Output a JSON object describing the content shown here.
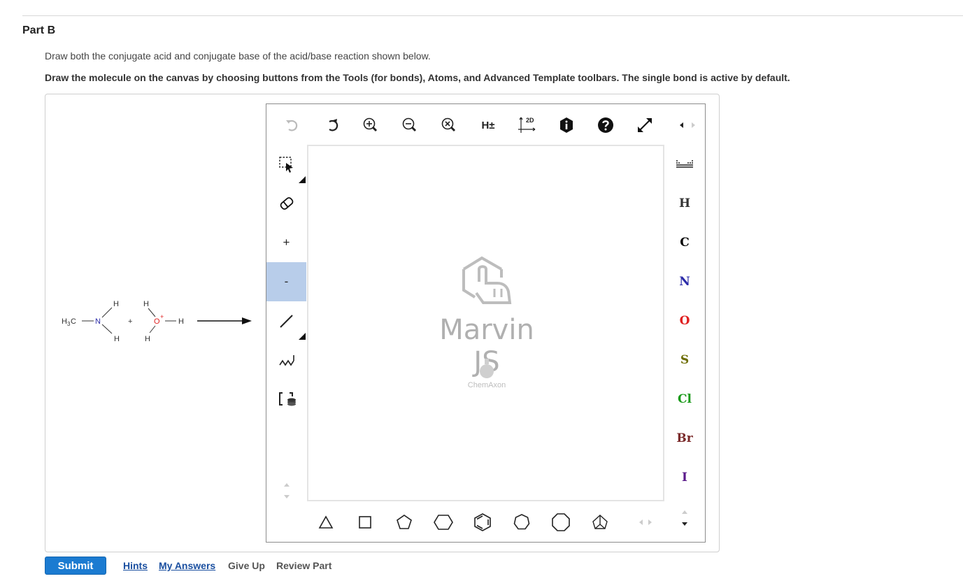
{
  "part": {
    "title": "Part B"
  },
  "instructions": {
    "line1": "Draw both the conjugate acid and conjugate base of the acid/base reaction shown below.",
    "line2": "Draw the molecule on the canvas by choosing buttons from the Tools (for bonds), Atoms, and Advanced Template toolbars. The single bond is active by default."
  },
  "reaction": {
    "methyl": "H",
    "methyl_sub": "3",
    "methyl_c": "C",
    "n": "N",
    "h_top_n": "H",
    "h_bot_n": "H",
    "plus": "+",
    "o": "O",
    "o_charge": "+",
    "h_top_o": "H",
    "h_bot_o": "H",
    "h_right_o": "H"
  },
  "editor": {
    "toolbar": {
      "hydrogen_label": "H±",
      "clean_label": "2D"
    },
    "leftbar": {
      "charge_plus": "+",
      "charge_minus": "-"
    },
    "canvas": {
      "watermark": "Marvin JS",
      "vendor": "ChemAxon"
    },
    "atoms": [
      {
        "symbol": "H",
        "color": "#333333"
      },
      {
        "symbol": "C",
        "color": "#000000"
      },
      {
        "symbol": "N",
        "color": "#2b2ba8"
      },
      {
        "symbol": "O",
        "color": "#e02020"
      },
      {
        "symbol": "S",
        "color": "#6b6b00"
      },
      {
        "symbol": "Cl",
        "color": "#1a9a1a"
      },
      {
        "symbol": "Br",
        "color": "#7a2a2a"
      },
      {
        "symbol": "I",
        "color": "#5a1a8a"
      }
    ],
    "accent_color": "#b8cdea"
  },
  "actions": {
    "submit": "Submit",
    "hints": "Hints",
    "my_answers": "My Answers",
    "give_up": "Give Up",
    "review_part": "Review Part"
  }
}
